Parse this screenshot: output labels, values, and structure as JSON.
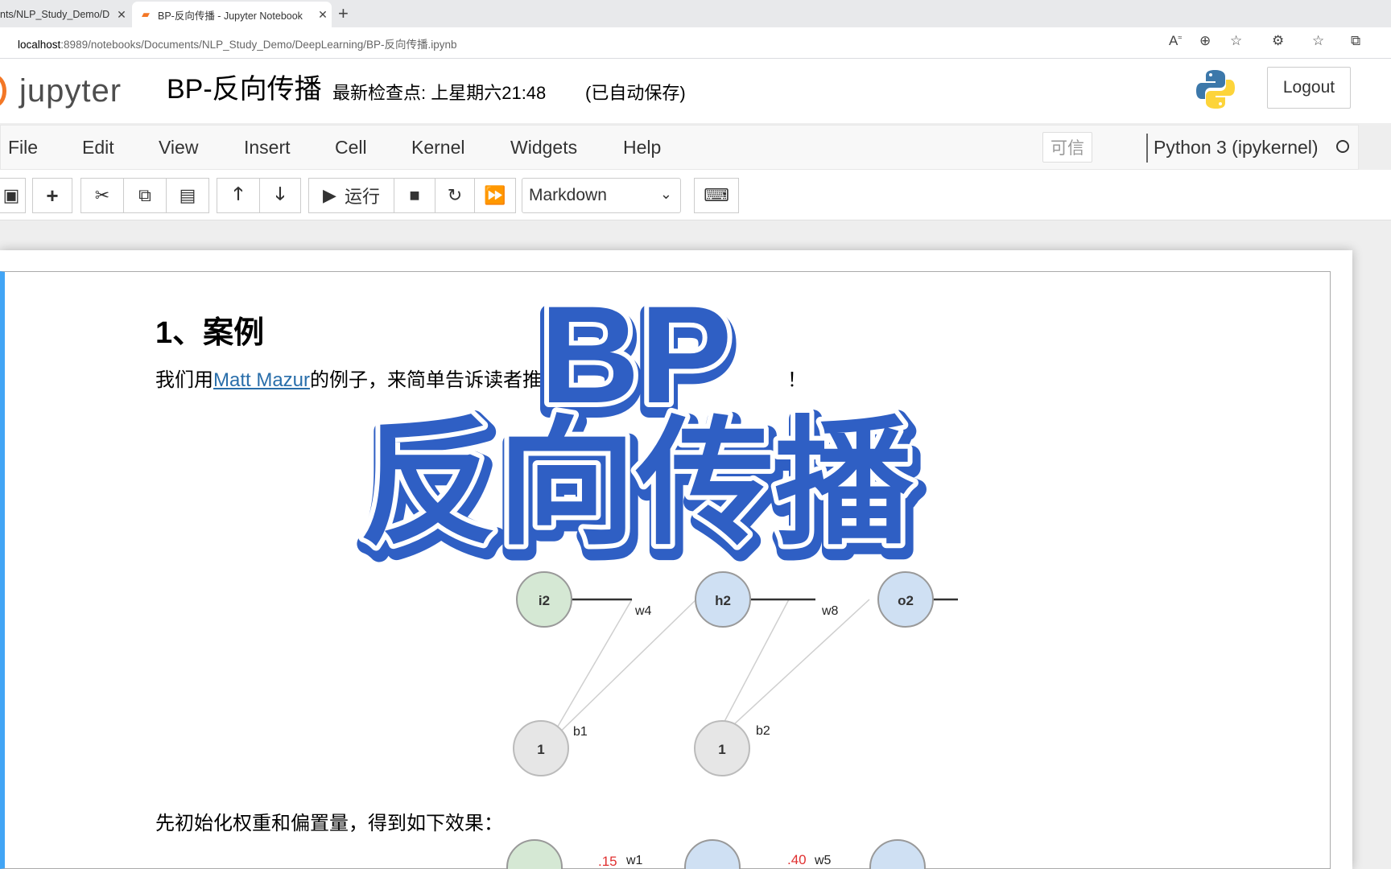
{
  "browser": {
    "tabs": [
      {
        "title": "nts/NLP_Study_Demo/D",
        "close": "✕"
      },
      {
        "title": "BP-反向传播 - Jupyter Notebook",
        "close": "✕"
      }
    ],
    "new_tab": "+",
    "url_host": "localhost",
    "url_path": ":8989/notebooks/Documents/NLP_Study_Demo/DeepLearning/BP-反向传播.ipynb"
  },
  "jupyter": {
    "logo_text": "jupyter",
    "notebook_name": "BP-反向传播",
    "checkpoint": "最新检查点: 上星期六21:48",
    "autosave": "(已自动保存)",
    "logout": "Logout",
    "menu": [
      "File",
      "Edit",
      "View",
      "Insert",
      "Cell",
      "Kernel",
      "Widgets",
      "Help"
    ],
    "trusted": "可信",
    "kernel_name": "Python 3 (ipykernel)",
    "run_label": "运行",
    "cell_type": "Markdown"
  },
  "notebook": {
    "heading": "1、案例",
    "para1_prefix": "我们用",
    "para1_link": "Matt Mazur",
    "para1_suffix": "的例子，来简单告诉读者推导过",
    "para1_end": "！",
    "para2": "先初始化权重和偏置量，得到如下效果：",
    "diagram": {
      "nodes": {
        "i2": "i2",
        "h2": "h2",
        "o2": "o2",
        "b1_node": "1",
        "b2_node": "1"
      },
      "labels": {
        "w4": "w4",
        "w8": "w8",
        "b1": "b1",
        "b2": "b2",
        "w5_top": "w5"
      }
    },
    "diagram2": {
      "w1_value": ".15",
      "w1": "w1",
      "w5_value": ".40",
      "w5": "w5"
    }
  },
  "overlay": {
    "line1": "BP",
    "line2": "反向传播"
  },
  "colors": {
    "jupyter_orange": "#f37726",
    "link": "#296eaa",
    "cell_selected": "#42a5f5",
    "overlay_blue": "#2f5fc4"
  }
}
